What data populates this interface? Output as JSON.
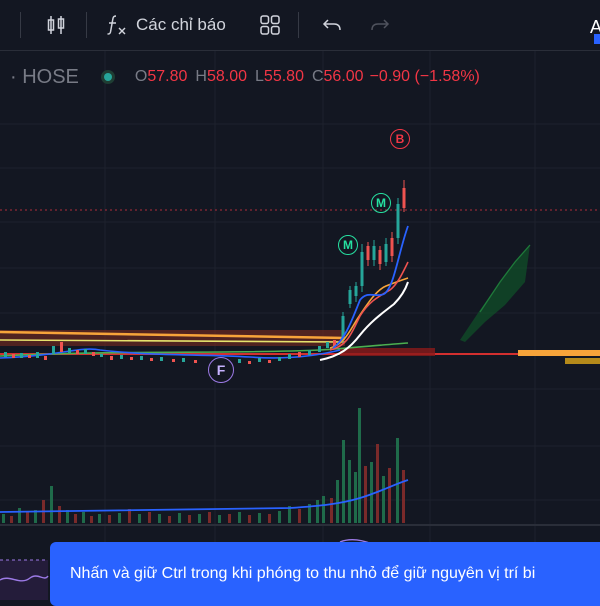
{
  "toolbar": {
    "indicators_label": "Các chỉ báo",
    "corner_letter": "A"
  },
  "legend": {
    "exchange": "· HOSE",
    "o_label": "O",
    "o_value": "57.80",
    "h_label": "H",
    "h_value": "58.00",
    "l_label": "L",
    "l_value": "55.80",
    "c_label": "C",
    "c_value": "56.00",
    "change": "−0.90 (−1.58%)"
  },
  "markers": {
    "buy": "B",
    "m1": "M",
    "m2": "M",
    "f": "F"
  },
  "toast": {
    "message": "Nhấn và giữ Ctrl trong khi phóng to thu nhỏ để giữ nguyên vị trí bi"
  },
  "colors": {
    "up": "#26a69a",
    "down": "#ef5350",
    "accent": "#2962ff",
    "background": "#131722"
  }
}
